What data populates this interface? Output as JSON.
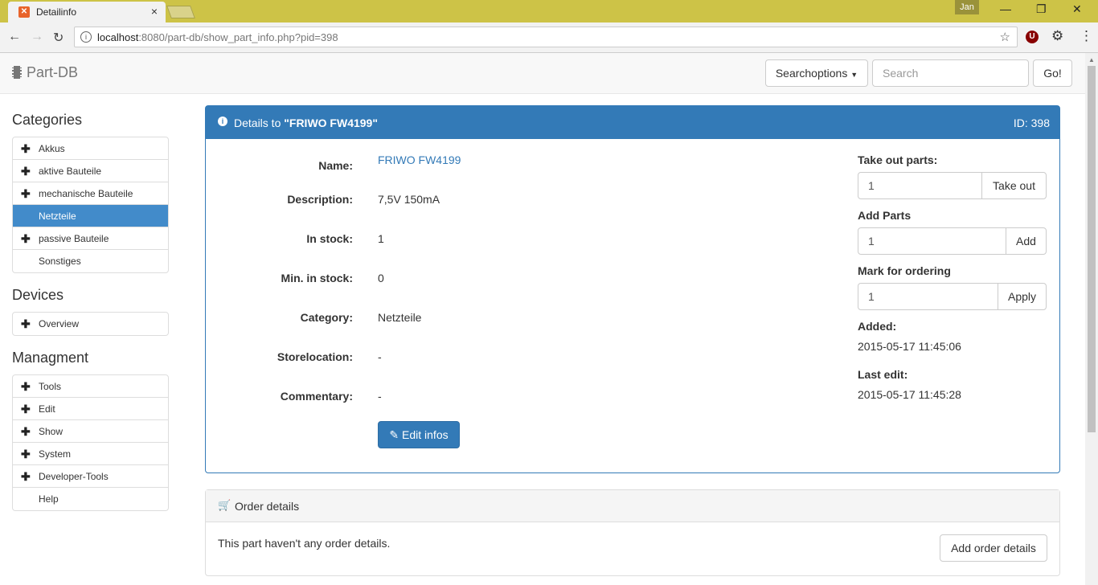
{
  "browser": {
    "tab_title": "Detailinfo",
    "tab_close": "×",
    "user": "Jan",
    "url_host": "localhost",
    "url_rest": ":8080/part-db/show_part_info.php?pid=398"
  },
  "header": {
    "brand": "Part-DB",
    "searchoptions_label": "Searchoptions",
    "search_placeholder": "Search",
    "go_label": "Go!"
  },
  "sidebar": {
    "categories_title": "Categories",
    "categories": [
      {
        "label": "Akkus",
        "plus": "✚"
      },
      {
        "label": "aktive Bauteile",
        "plus": "✚"
      },
      {
        "label": "mechanische Bauteile",
        "plus": "✚"
      },
      {
        "label": "Netzteile",
        "plus": ""
      },
      {
        "label": "passive Bauteile",
        "plus": "✚"
      },
      {
        "label": "Sonstiges",
        "plus": ""
      }
    ],
    "devices_title": "Devices",
    "devices": [
      {
        "label": "Overview",
        "plus": "✚"
      }
    ],
    "managment_title": "Managment",
    "managment": [
      {
        "label": "Tools",
        "plus": "✚"
      },
      {
        "label": "Edit",
        "plus": "✚"
      },
      {
        "label": "Show",
        "plus": "✚"
      },
      {
        "label": "System",
        "plus": "✚"
      },
      {
        "label": "Developer-Tools",
        "plus": "✚"
      },
      {
        "label": "Help",
        "plus": ""
      }
    ]
  },
  "details": {
    "title_prefix": "Details to ",
    "title_name": "\"FRIWO FW4199\"",
    "id_label": "ID: 398",
    "fields": {
      "name_label": "Name:",
      "name_value": "FRIWO FW4199",
      "description_label": "Description:",
      "description_value": "7,5V 150mA",
      "instock_label": "In stock:",
      "instock_value": "1",
      "mininstock_label": "Min. in stock:",
      "mininstock_value": "0",
      "category_label": "Category:",
      "category_value": "Netzteile",
      "storelocation_label": "Storelocation:",
      "storelocation_value": "-",
      "commentary_label": "Commentary:",
      "commentary_value": "-"
    },
    "edit_label": "Edit infos",
    "takeout_label": "Take out parts:",
    "takeout_value": "1",
    "takeout_button": "Take out",
    "add_label": "Add Parts",
    "add_value": "1",
    "add_button": "Add",
    "order_label": "Mark for ordering",
    "order_value": "1",
    "order_button": "Apply",
    "added_label": "Added:",
    "added_value": "2015-05-17 11:45:06",
    "lastedit_label": "Last edit:",
    "lastedit_value": "2015-05-17 11:45:28"
  },
  "order": {
    "title": "Order details",
    "empty_text": "This part haven't any order details.",
    "add_button": "Add order details"
  }
}
